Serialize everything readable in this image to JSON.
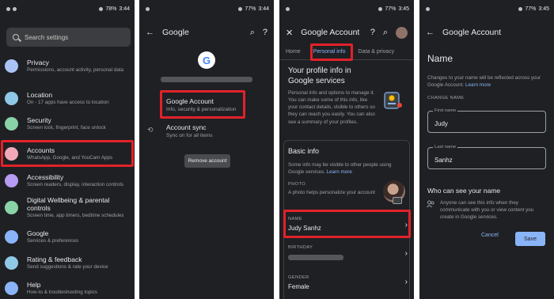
{
  "panel1": {
    "status": {
      "time": "3:44",
      "battery": "78%"
    },
    "search": {
      "placeholder": "Search settings"
    },
    "items": [
      {
        "title": "Privacy",
        "sub": "Permissions, account activity, personal data",
        "color": "#a9c3f5",
        "icon": "privacy-icon"
      },
      {
        "title": "Location",
        "sub": "On - 17 apps have access to location",
        "color": "#8fc9e8",
        "icon": "location-icon"
      },
      {
        "title": "Security",
        "sub": "Screen lock, fingerprint, face unlock",
        "color": "#8ad3a8",
        "icon": "security-icon"
      },
      {
        "title": "Accounts",
        "sub": "WhatsApp, Google, and YouCam Apps",
        "color": "#f2a8b8",
        "icon": "accounts-icon"
      },
      {
        "title": "Accessibility",
        "sub": "Screen readers, display, interaction controls",
        "color": "#b79bf0",
        "icon": "accessibility-icon"
      },
      {
        "title": "Digital Wellbeing & parental controls",
        "sub": "Screen time, app timers, bedtime schedules",
        "color": "#8ad3a8",
        "icon": "wellbeing-icon"
      },
      {
        "title": "Google",
        "sub": "Services & preferences",
        "color": "#8ab4f8",
        "icon": "google-icon"
      },
      {
        "title": "Rating & feedback",
        "sub": "Send suggestions & rate your device",
        "color": "#8fc9e8",
        "icon": "rating-icon"
      },
      {
        "title": "Help",
        "sub": "How-to & troubleshooting topics",
        "color": "#8ab4f8",
        "icon": "help-icon"
      }
    ]
  },
  "panel2": {
    "status": {
      "time": "3:44",
      "battery": "77%"
    },
    "title": "Google",
    "avatar_letter": "G",
    "google_account": {
      "title": "Google Account",
      "sub": "Info, security & personalization"
    },
    "account_sync": {
      "title": "Account sync",
      "sub": "Sync on for all items"
    },
    "remove_button": "Remove account"
  },
  "panel3": {
    "status": {
      "time": "3:45",
      "battery": "77%"
    },
    "title": "Google Account",
    "tabs": [
      "Home",
      "Personal info",
      "Data & privacy"
    ],
    "profile_title": "Your profile info in Google services",
    "profile_desc": "Personal info and options to manage it. You can make some of this info, like your contact details, visible to others so they can reach you easily. You can also see a summary of your profiles.",
    "basic_info": {
      "title": "Basic info",
      "desc": "Some info may be visible to other people using Google services.",
      "learn_more": "Learn more"
    },
    "photo": {
      "label": "PHOTO",
      "desc": "A photo helps personalize your account"
    },
    "name": {
      "label": "NAME",
      "value": "Judy Sanhz"
    },
    "birthday": {
      "label": "BIRTHDAY"
    },
    "gender": {
      "label": "GENDER",
      "value": "Female"
    }
  },
  "panel4": {
    "status": {
      "time": "3:45",
      "battery": "77%"
    },
    "title": "Google Account",
    "heading": "Name",
    "desc": "Changes to your name will be reflected across your Google Account.",
    "learn_more": "Learn more",
    "section_label": "CHANGE NAME",
    "first_name": {
      "label": "First name",
      "value": "Judy"
    },
    "last_name": {
      "label": "Last name",
      "value": "Sanhz"
    },
    "who_title": "Who can see your name",
    "who_desc": "Anyone can see this info when they communicate with you or view content you create in Google services.",
    "cancel": "Cancel",
    "save": "Save"
  },
  "colors": {
    "highlight": "#e1222b",
    "accent": "#8ab4f8",
    "background": "#1f2023"
  }
}
